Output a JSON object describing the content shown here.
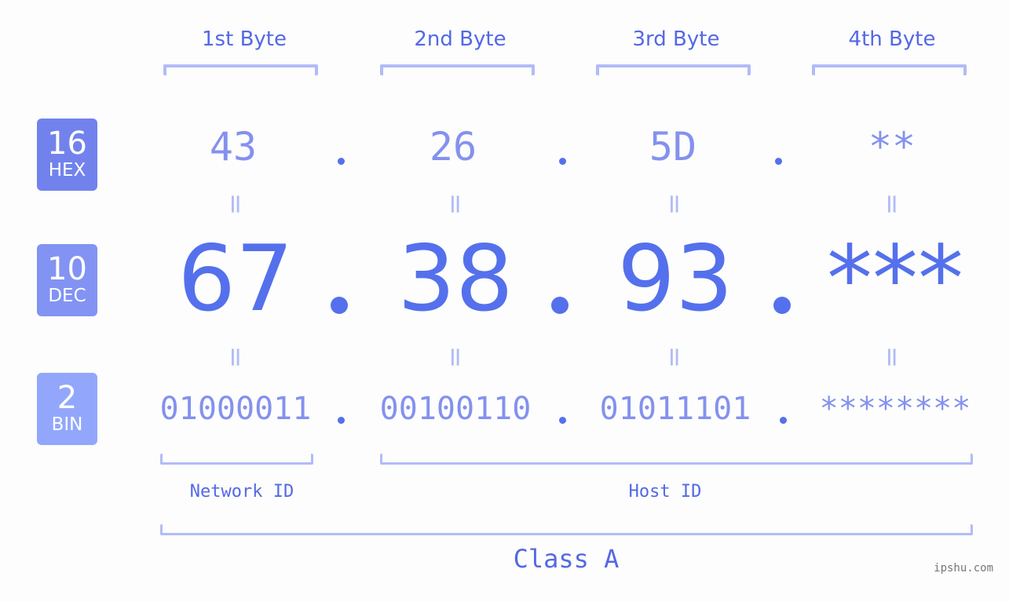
{
  "byte_headers": [
    "1st Byte",
    "2nd Byte",
    "3rd Byte",
    "4th Byte"
  ],
  "badges": [
    {
      "number": "16",
      "label": "HEX",
      "color": "#7282ed"
    },
    {
      "number": "10",
      "label": "DEC",
      "color": "#8293f3"
    },
    {
      "number": "2",
      "label": "BIN",
      "color": "#92a7fb"
    }
  ],
  "hex": [
    "43",
    "26",
    "5D",
    "**"
  ],
  "dec": [
    "67",
    "38",
    "93",
    "***"
  ],
  "bin": [
    "01000011",
    "00100110",
    "01011101",
    "********"
  ],
  "equals_symbol": "=",
  "sections": {
    "network": "Network ID",
    "host": "Host ID",
    "class": "Class A"
  },
  "watermark": "ipshu.com",
  "colors": {
    "primary": "#5570ec",
    "light": "#8491ee",
    "bracket": "#b2bbf7"
  }
}
